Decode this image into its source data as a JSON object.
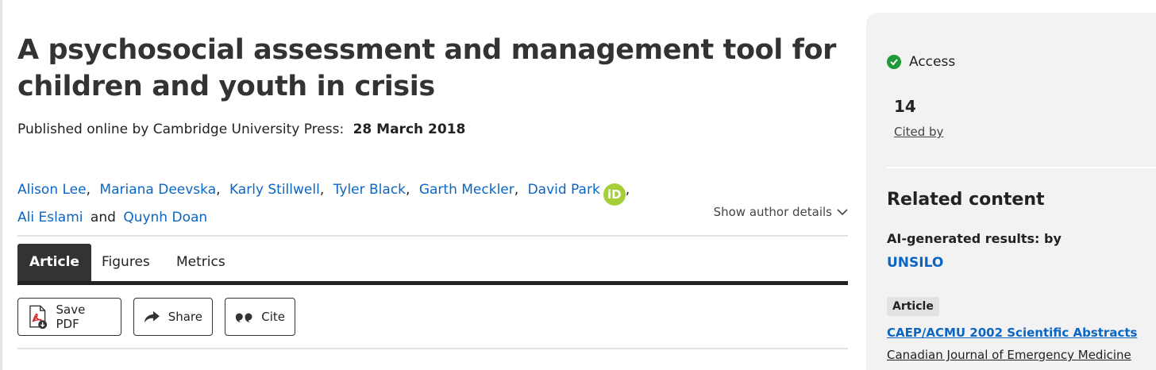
{
  "article": {
    "title": "A psychosocial assessment and management tool for children and youth in crisis",
    "published_prefix": "Published online by Cambridge University Press:",
    "published_date": "28 March 2018"
  },
  "authors": {
    "names": [
      "Alison Lee",
      "Mariana Deevska",
      "Karly Stillwell",
      "Tyler Black",
      "Garth Meckler",
      "David Park",
      "Ali Eslami",
      "Quynh Doan"
    ],
    "orcid_label": "iD",
    "conjunction": "and",
    "show_details": "Show author details"
  },
  "tabs": [
    "Article",
    "Figures",
    "Metrics"
  ],
  "actions": {
    "save_pdf": "Save PDF",
    "share": "Share",
    "cite": "Cite"
  },
  "sidebar": {
    "access_label": "Access",
    "cited_count": "14",
    "cited_label": "Cited by",
    "related_heading": "Related content",
    "ai_results_label": "AI-generated results: by",
    "ai_provider": "UNSILO",
    "related_items": [
      {
        "type": "Article",
        "title": "CAEP/ACMU 2002 Scientific Abstracts",
        "journal": "Canadian Journal of Emergency Medicine"
      }
    ]
  },
  "icons": {
    "access": "check-circle-icon",
    "orcid": "orcid-icon",
    "chevron": "chevron-down-icon",
    "pdf": "pdf-file-icon",
    "share": "share-arrow-icon",
    "cite": "quote-icon"
  },
  "colors": {
    "link": "#0b66c3",
    "access_green": "#1e9a3a",
    "orcid_green": "#a6ce39",
    "active_tab": "#333333",
    "sidebar_bg": "#f2f2f2"
  }
}
